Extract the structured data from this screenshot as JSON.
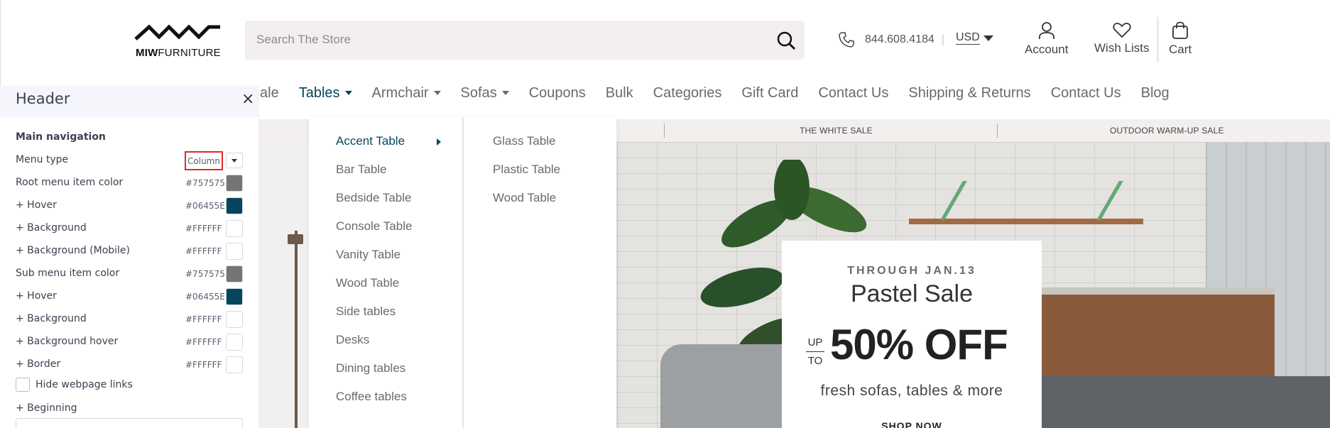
{
  "header": {
    "logo": {
      "bold": "MIW",
      "rest": "FURNITURE"
    },
    "search": {
      "placeholder": "Search The Store"
    },
    "phone": "844.608.4184",
    "currency": "USD",
    "account_label": "Account",
    "wishlist_label": "Wish Lists",
    "cart_label": "Cart"
  },
  "nav": {
    "items": [
      {
        "label": "n Sale"
      },
      {
        "label": "Tables"
      },
      {
        "label": "Armchair"
      },
      {
        "label": "Sofas"
      },
      {
        "label": "Coupons"
      },
      {
        "label": "Bulk"
      },
      {
        "label": "Categories"
      },
      {
        "label": "Gift Card"
      },
      {
        "label": "Contact Us"
      },
      {
        "label": "Shipping & Returns"
      },
      {
        "label": "Contact Us"
      },
      {
        "label": "Blog"
      }
    ]
  },
  "mega_menu": {
    "primary": [
      "Accent Table",
      "Bar Table",
      "Bedside Table",
      "Console Table",
      "Vanity Table",
      "Wood Table",
      "Side tables",
      "Desks",
      "Dining tables",
      "Coffee tables"
    ],
    "secondary": [
      "Glass Table",
      "Plastic Table",
      "Wood Table"
    ]
  },
  "promo": {
    "items": [
      "THE WHITE SALE",
      "OUTDOOR WARM-UP SALE"
    ]
  },
  "hero": {
    "through": "THROUGH JAN.13",
    "title": "Pastel Sale",
    "up": "UP",
    "to": "TO",
    "big": "50% OFF",
    "subtitle": "fresh sofas, tables & more",
    "cta": "SHOP NOW"
  },
  "panel": {
    "title": "Header",
    "close": "×",
    "section": "Main navigation",
    "menu_type_label": "Menu type",
    "menu_type_value": "Column",
    "rows": [
      {
        "label": "Root menu item color",
        "hex": "#757575",
        "color": "#757575"
      },
      {
        "label": "+ Hover",
        "hex": "#06455E",
        "color": "#06455E"
      },
      {
        "label": "+ Background",
        "hex": "#FFFFFF",
        "color": "#FFFFFF"
      },
      {
        "label": "+ Background (Mobile)",
        "hex": "#FFFFFF",
        "color": "#FFFFFF"
      },
      {
        "label": "Sub menu item color",
        "hex": "#757575",
        "color": "#757575"
      },
      {
        "label": "+ Hover",
        "hex": "#06455E",
        "color": "#06455E"
      },
      {
        "label": "+ Background",
        "hex": "#FFFFFF",
        "color": "#FFFFFF"
      },
      {
        "label": "+ Background hover",
        "hex": "#FFFFFF",
        "color": "#FFFFFF"
      },
      {
        "label": "+ Border",
        "hex": "#FFFFFF",
        "color": "#FFFFFF"
      }
    ],
    "hide_links_label": "Hide webpage links",
    "beginning_label": "+ Beginning"
  },
  "colors": {
    "accent": "#06455e",
    "highlight_border": "#e4282a"
  }
}
